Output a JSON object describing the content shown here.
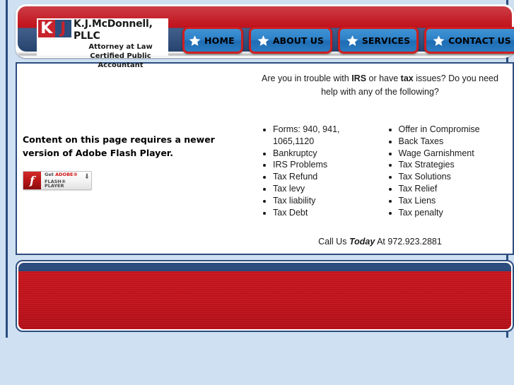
{
  "theme": {
    "page_background": "#cfe0f2",
    "header_red": "#c1121c",
    "header_navy": "#2c4d7e",
    "button_border_red": "#cf1f1f",
    "button_blue": "#2f82c8",
    "footer_red": "#c1121c"
  },
  "header": {
    "logo": {
      "mark_k": "K",
      "mark_j": "J",
      "firm_name": "K.J.McDonnell, PLLC",
      "line2": "Attorney at Law",
      "line3": "Certified Public Accountant"
    },
    "nav": [
      {
        "label": "HOME",
        "icon": "star-icon"
      },
      {
        "label": "ABOUT US",
        "icon": "star-icon"
      },
      {
        "label": "SERVICES",
        "icon": "star-icon"
      },
      {
        "label": "CONTACT US",
        "icon": "star-icon"
      }
    ]
  },
  "main": {
    "flash": {
      "message_line1": "Content on this page requires a newer version of",
      "message_line2": "Adobe Flash Player.",
      "badge": {
        "get_label": "Get ",
        "adobe_label": "ADOBE®",
        "product_label": "FLASH® PLAYER",
        "download_icon": "download-arrow-icon"
      }
    },
    "intro": {
      "part1": "Are you in trouble with ",
      "bold1": "IRS",
      "part2": " or have ",
      "bold2": "tax",
      "part3": " issues? Do you need help with any of the following?"
    },
    "services_left": [
      "Forms: 940, 941, 1065,1120",
      "Bankruptcy",
      "IRS Problems",
      "Tax Refund",
      "Tax levy",
      "Tax liability",
      "Tax Debt"
    ],
    "services_right": [
      "Offer in Compromise",
      "Back Taxes",
      "Wage Garnishment",
      "Tax Strategies",
      "Tax Solutions",
      "Tax Relief",
      "Tax Liens",
      "Tax penalty"
    ],
    "call_to_action": {
      "prefix": "Call Us ",
      "emphasis": "Today",
      "suffix": " At 972.923.2881"
    }
  }
}
